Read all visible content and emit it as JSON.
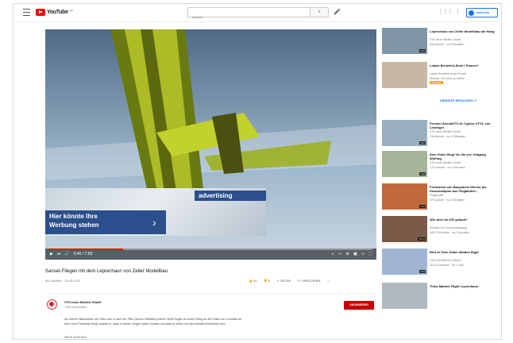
{
  "header": {
    "logo_text": "YouTube",
    "logo_country": "DE",
    "search_placeholder": "Suchen",
    "signin_label": "ANMELDEN"
  },
  "player": {
    "time": "0:46 / 7:59",
    "progress_fraction": 0.23
  },
  "ad": {
    "tag": "advertising",
    "line1": "Hier könnte Ihre",
    "line2": "Werbung stehen"
  },
  "video": {
    "title": "Sanset-Fliegen mit dem Leprechaun von Zeller Modellbau",
    "views": "691 Aufrufe · 13.03.2021",
    "likes": "31",
    "dislikes": "0",
    "share": "TEILEN",
    "save": "SPEICHERN"
  },
  "channel": {
    "name": "VTH neue Medien GmbH",
    "subs": "7.840 Abonnenten",
    "subscribe": "ABONNIEREN",
    "description": "Als Werner Baumeister ein Video sah, in dem der Pilot (Jochen Windfeld) seinen Veldt-Segler an einem Hang an der Küste von Cornwall mit dem Hund Fransekin fliegt, wusste er, dass er diesen Segler haben musste und dass er weiter von dem Modell mitnehmen wird.",
    "more": "MEHR ANSEHEN"
  },
  "sidebar": {
    "visit_label": "WEBSITE BESUCHEN",
    "items": [
      {
        "title": "Leprechaun von Zeller Modellbau am Hang",
        "channel": "VTH neue Medien GmbH",
        "views": "696 Aufrufe · vor 5 Monaten",
        "duration": "6:03",
        "color": "#7f95a6"
      },
      {
        "title": "Lokale Bretzfeld-Ärzte? Frauen?",
        "channel": "Lokale Bretzfeld-Ärzte Frauen",
        "views": "Möchten Sie Ärzte zu treffen",
        "duration": "",
        "color": "#c7b8a6",
        "ad": "Anzeige"
      },
      {
        "title": "Premier Aircraft FV-31 Cypher VTOL von Lindinger",
        "channel": "VTH neue Medien GmbH",
        "views": "236 Aufrufe · vor 10 Monaten",
        "duration": "3:42",
        "color": "#9ab0c2"
      },
      {
        "title": "Dein Video fliegt Vis die see Veltgang Wolfrag",
        "channel": "VTH neue Medien GmbH",
        "views": "2,1K Aufrufe · vor 2 Monaten",
        "duration": "7:24",
        "color": "#a8b49a"
      },
      {
        "title": "Fortissimo von Baupakete Werner als Downloadplan aus FlugModell...",
        "channel": "FlugModell",
        "views": "479 Aufrufe · vor 6 Monaten",
        "duration": "4:12",
        "color": "#c06a3c"
      },
      {
        "title": "Wie wird ein ICE gebaut?",
        "channel": "Einstein vor Sonnenuntergang",
        "views": "498.719 Aufrufe · vor 4 Monaten",
        "duration": "10:13",
        "color": "#7a5a48"
      },
      {
        "title": "Bird of Time Glider Maiden flight",
        "channel": "John Henfield RC Gliders",
        "views": "114.203 Aufrufe · vor 1 Jahr",
        "duration": "2:42",
        "color": "#9fb5d2"
      },
      {
        "title": "Tinko Maiden Flight Leprechaun",
        "channel": "",
        "views": "",
        "duration": "",
        "color": "#b0b8c0"
      }
    ]
  }
}
